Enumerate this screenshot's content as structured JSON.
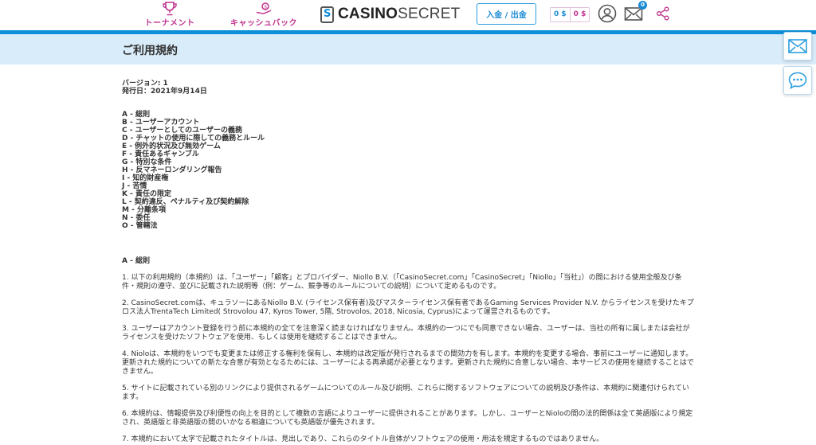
{
  "header": {
    "nav": {
      "tournament": "トーナメント",
      "cashback": "キャッシュバック"
    },
    "logo": {
      "part1": "CASINO",
      "part2": "SECRET"
    },
    "deposit_label": "入金 / 出金",
    "balance_a": "0 $",
    "balance_b": "0 $",
    "mail_badge": "0",
    "colors": {
      "accent_blue": "#0d8fd9",
      "accent_pink": "#c0348e",
      "title_bar": "#d9ecf9"
    }
  },
  "page": {
    "title": "ご利用規約",
    "version": "バージョン: 1",
    "issued": "発行日：2021年9月14日",
    "toc": [
      "A - 総則",
      "B - ユーザーアカウント",
      "C - ユーザーとしてのユーザーの義務",
      "D - チャットの使用に際しての義務とルール",
      "E - 例外的状況及び無効ゲーム",
      "F - 責任あるギャンブル",
      "G - 特別な条件",
      "H - 反マネーロンダリング報告",
      "I - 知的財産権",
      "J - 苦情",
      "K - 責任の限定",
      "L - 契約違反、ペナルティ及び契約解除",
      "M - 分離条項",
      "N - 委任",
      "O - 管轄法"
    ],
    "section_heading": "A - 総則",
    "paragraphs": [
      "1. 以下の利用規約（本規約）は、「ユーザー」「顧客」とプロバイダー、Niollo B.V.（「CasinoSecret.com」「CasinoSecret」「Niollo」「当社」）の間における使用全般及び条件・規則の遵守、並びに記載された説明等（例：ゲーム、競争等のルールについての説明）について定めるものです。",
      "2. CasinoSecret.comは、キュラソーにあるNiollo B.V. (ライセンス保有者)及びマスターライセンス保有者であるGaming Services Provider N.V. からライセンスを受けたキプロス法人TrentaTech Limited( Strovolou 47, Kyros Tower, 5階, Strovolos, 2018, Nicosia, Cyprus)によって運営されるものです。",
      "3. ユーザーはアカウント登録を行う前に本規約の全てを注意深く読まなければなりません。本規約の一つにでも同意できない場合、ユーザーは、当社の所有に属しまたは会社がライセンスを受けたソフトウェアを使用、もしくは使用を継続することはできません。",
      "4. Nioloは、本規約をいつでも変更または修正する権利を保有し、本規約は改定版が発行されるまでの間効力を有します。本規約を変更する場合、事前にユーザーに通知します。更新された規約についての新たな合意が有効となるためには、ユーザーによる再承諾が必要となります。更新された規約に合意しない場合、本サービスの使用を継続することはできません。",
      "5. サイトに記載されている別のリンクにより提供されるゲームについてのルール及び説明、これらに関するソフトウェアについての説明及び条件は、本規約に関連付けられています。",
      "6. 本規約は、情報提供及び利便性の向上を目的として複数の言語によりユーザーに提供されることがあります。しかし、ユーザーとNioloの間の法的関係は全て英語版により規定され、英語版と非英語版の間のいかなる相違についても英語版が優先されます。",
      "7. 本規約において太字で記載されたタイトルは、見出しであり、これらのタイトル自体がソフトウェアの使用・用法を規定するものではありません。"
    ]
  }
}
